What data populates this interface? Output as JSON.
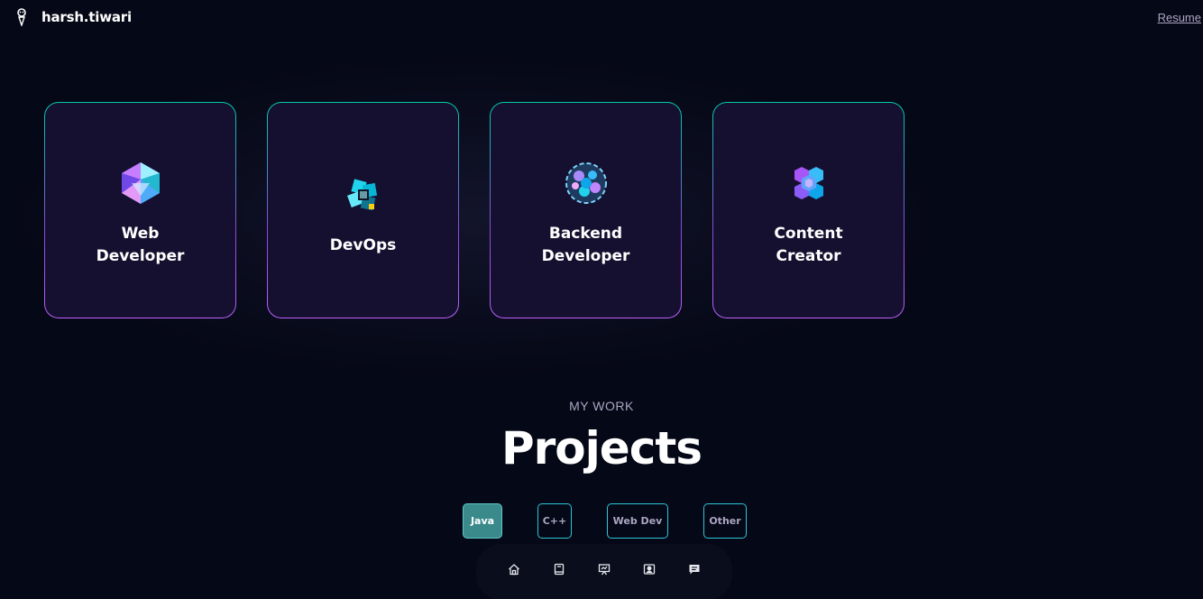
{
  "header": {
    "brand_name": "harsh.tiwari",
    "brand_logo_icon": "developer-avatar-icon",
    "resume_label": "Resume"
  },
  "services": [
    {
      "title": "Web Developer",
      "icon": "crystal-polyhedron-icon",
      "title_line1": "Web",
      "title_line2": "Developer"
    },
    {
      "title": "DevOps",
      "icon": "cube-cluster-icon"
    },
    {
      "title": "Backend Developer",
      "icon": "sphere-orb-icon",
      "title_line1": "Backend",
      "title_line2": "Developer"
    },
    {
      "title": "Content Creator",
      "icon": "hexagon-cluster-icon",
      "title_line1": "Content",
      "title_line2": "Creator"
    }
  ],
  "projects": {
    "subtitle": "MY WORK",
    "title": "Projects",
    "filters": [
      {
        "label": "Java",
        "active": true
      },
      {
        "label": "C++",
        "active": false
      },
      {
        "label": "Web Dev",
        "active": false
      },
      {
        "label": "Other",
        "active": false
      }
    ]
  },
  "bottom_nav": {
    "items": [
      "home-icon",
      "book-icon",
      "presentation-icon",
      "contact-card-icon",
      "chat-icon"
    ]
  },
  "colors": {
    "background": "#050816",
    "card_bg": "#151030",
    "accent_teal": "#00cea8",
    "accent_purple": "#bf61ff",
    "secondary_text": "#aaa6c3"
  }
}
